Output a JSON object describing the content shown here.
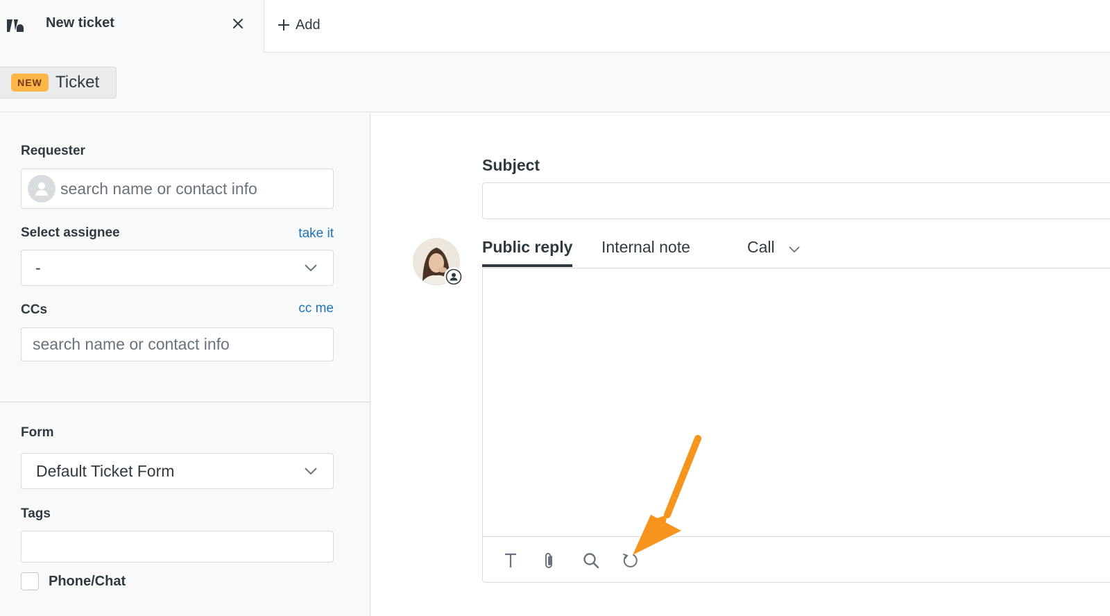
{
  "top_tabs": {
    "active_tab": {
      "title": "New ticket",
      "close_icon": "close-icon"
    },
    "add_button": {
      "label": "Add",
      "icon": "plus-icon"
    },
    "logo_icon": "zendesk-logo-icon"
  },
  "subheader": {
    "badge": "NEW",
    "label": "Ticket",
    "badge_color": "#ffb648"
  },
  "sidebar": {
    "requester": {
      "label": "Requester",
      "placeholder": "search name or contact info",
      "icon": "user-avatar-icon"
    },
    "assignee": {
      "label": "Select assignee",
      "link": "take it",
      "value": "-",
      "icon": "chevron-down-icon"
    },
    "ccs": {
      "label": "CCs",
      "link": "cc me",
      "placeholder": "search name or contact info"
    },
    "form": {
      "label": "Form",
      "value": "Default Ticket Form",
      "icon": "chevron-down-icon"
    },
    "tags": {
      "label": "Tags",
      "value": ""
    },
    "phone_chat": {
      "label": "Phone/Chat",
      "checked": false
    }
  },
  "main": {
    "subject": {
      "label": "Subject",
      "value": ""
    },
    "reply_tabs": [
      {
        "label": "Public reply",
        "active": true
      },
      {
        "label": "Internal note",
        "active": false
      },
      {
        "label": "Call",
        "active": false,
        "icon": "chevron-down-icon"
      }
    ],
    "toolbar_icons": [
      "text-format-icon",
      "paperclip-icon",
      "search-icon",
      "macro-undo-icon"
    ],
    "annotation_icon": "orange-arrow-annotation",
    "annotation_color": "#f7941d",
    "link_color": "#1f73b7"
  }
}
